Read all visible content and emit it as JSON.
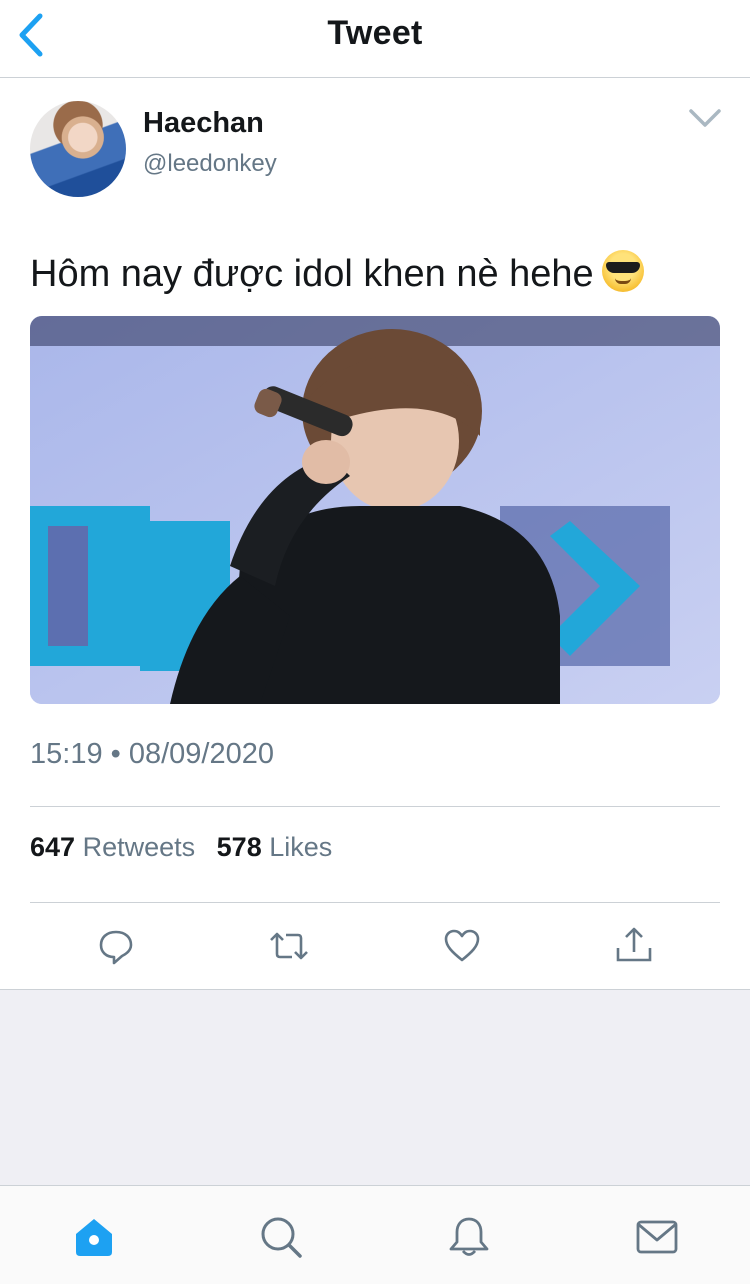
{
  "header": {
    "title": "Tweet",
    "back_icon": "chevron-left-icon"
  },
  "tweet": {
    "author": {
      "display_name": "Haechan",
      "handle": "@leedonkey"
    },
    "text": "Hôm nay được idol khen nè hehe",
    "emoji": "smiling-face-with-sunglasses",
    "timestamp": "15:19 • 08/09/2020",
    "stats": {
      "retweets_count": "647",
      "retweets_label": "Retweets",
      "likes_count": "578",
      "likes_label": "Likes"
    },
    "actions": [
      "reply-icon",
      "retweet-icon",
      "like-icon",
      "share-icon"
    ]
  },
  "tabbar": {
    "items": [
      "home-icon",
      "search-icon",
      "notifications-icon",
      "messages-icon"
    ],
    "active": "home-icon"
  },
  "colors": {
    "accent": "#1da1f2",
    "text_primary": "#14171a",
    "text_secondary": "#657786",
    "divider": "#ccd1d6",
    "background_grey": "#efeff4"
  }
}
